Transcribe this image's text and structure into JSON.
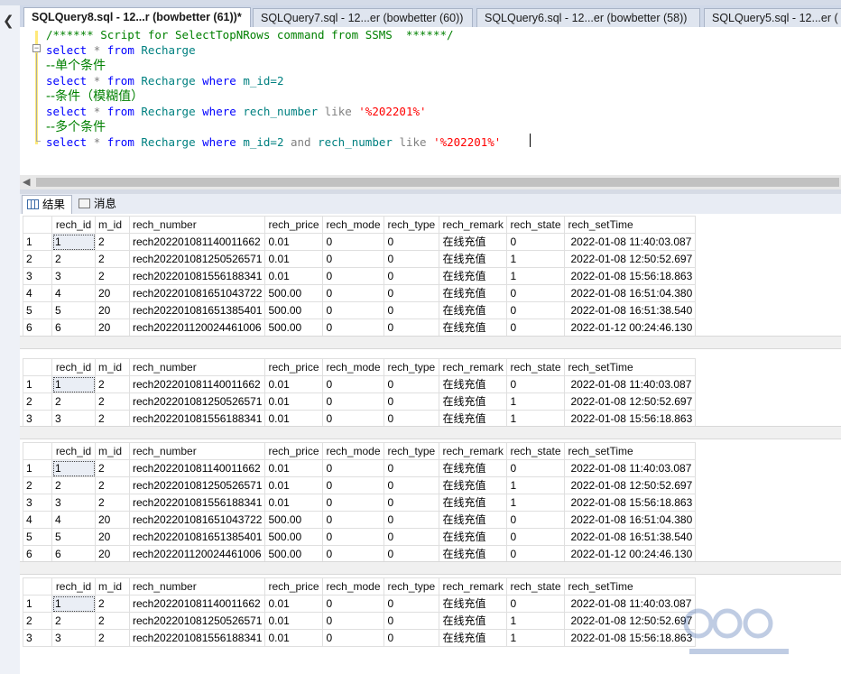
{
  "tabs": [
    {
      "label": "SQLQuery8.sql - 12...r (bowbetter (61))*",
      "close": "",
      "active": true
    },
    {
      "label": "SQLQuery7.sql - 12...er (bowbetter (60))",
      "close": "",
      "active": false
    },
    {
      "label": "SQLQuery6.sql - 12...er (bowbetter (58))",
      "close": "",
      "active": false
    },
    {
      "label": "SQLQuery5.sql - 12...er (",
      "close": "",
      "active": false
    }
  ],
  "editor": {
    "line1": "/****** Script for SelectTopNRows command from SSMS  ******/",
    "line2": {
      "kw1": "select",
      "star": "*",
      "kw2": "from",
      "tbl": "Recharge"
    },
    "line3": "--单个条件",
    "line4": {
      "kw1": "select",
      "star": "*",
      "kw2": "from",
      "tbl": "Recharge",
      "kw3": "where",
      "cond": "m_id=2"
    },
    "line5": "--条件（模糊值）",
    "line6": {
      "kw1": "select",
      "star": "*",
      "kw2": "from",
      "tbl": "Recharge",
      "kw3": "where",
      "col": "rech_number",
      "op": "like",
      "str": "'%202201%'"
    },
    "line7": "--多个条件",
    "line8": {
      "kw1": "select",
      "star": "*",
      "kw2": "from",
      "tbl": "Recharge",
      "kw3": "where",
      "cond": "m_id=2",
      "and": "and",
      "col": "rech_number",
      "op": "like",
      "str": "'%202201%'"
    }
  },
  "result_tabs": {
    "results": "结果",
    "messages": "消息"
  },
  "columns": [
    "rech_id",
    "m_id",
    "rech_number",
    "rech_price",
    "rech_mode",
    "rech_type",
    "rech_remark",
    "rech_state",
    "rech_setTime"
  ],
  "grids": [
    {
      "rows": [
        [
          "1",
          "1",
          "2",
          "rech202201081140011662",
          "0.01",
          "0",
          "0",
          "在线充值",
          "0",
          "2022-01-08 11:40:03.087"
        ],
        [
          "2",
          "2",
          "2",
          "rech202201081250526571",
          "0.01",
          "0",
          "0",
          "在线充值",
          "1",
          "2022-01-08 12:50:52.697"
        ],
        [
          "3",
          "3",
          "2",
          "rech202201081556188341",
          "0.01",
          "0",
          "0",
          "在线充值",
          "1",
          "2022-01-08 15:56:18.863"
        ],
        [
          "4",
          "4",
          "20",
          "rech202201081651043722",
          "500.00",
          "0",
          "0",
          "在线充值",
          "0",
          "2022-01-08 16:51:04.380"
        ],
        [
          "5",
          "5",
          "20",
          "rech202201081651385401",
          "500.00",
          "0",
          "0",
          "在线充值",
          "0",
          "2022-01-08 16:51:38.540"
        ],
        [
          "6",
          "6",
          "20",
          "rech202201120024461006",
          "500.00",
          "0",
          "0",
          "在线充值",
          "0",
          "2022-01-12 00:24:46.130"
        ]
      ]
    },
    {
      "rows": [
        [
          "1",
          "1",
          "2",
          "rech202201081140011662",
          "0.01",
          "0",
          "0",
          "在线充值",
          "0",
          "2022-01-08 11:40:03.087"
        ],
        [
          "2",
          "2",
          "2",
          "rech202201081250526571",
          "0.01",
          "0",
          "0",
          "在线充值",
          "1",
          "2022-01-08 12:50:52.697"
        ],
        [
          "3",
          "3",
          "2",
          "rech202201081556188341",
          "0.01",
          "0",
          "0",
          "在线充值",
          "1",
          "2022-01-08 15:56:18.863"
        ]
      ]
    },
    {
      "rows": [
        [
          "1",
          "1",
          "2",
          "rech202201081140011662",
          "0.01",
          "0",
          "0",
          "在线充值",
          "0",
          "2022-01-08 11:40:03.087"
        ],
        [
          "2",
          "2",
          "2",
          "rech202201081250526571",
          "0.01",
          "0",
          "0",
          "在线充值",
          "1",
          "2022-01-08 12:50:52.697"
        ],
        [
          "3",
          "3",
          "2",
          "rech202201081556188341",
          "0.01",
          "0",
          "0",
          "在线充值",
          "1",
          "2022-01-08 15:56:18.863"
        ],
        [
          "4",
          "4",
          "20",
          "rech202201081651043722",
          "500.00",
          "0",
          "0",
          "在线充值",
          "0",
          "2022-01-08 16:51:04.380"
        ],
        [
          "5",
          "5",
          "20",
          "rech202201081651385401",
          "500.00",
          "0",
          "0",
          "在线充值",
          "0",
          "2022-01-08 16:51:38.540"
        ],
        [
          "6",
          "6",
          "20",
          "rech202201120024461006",
          "500.00",
          "0",
          "0",
          "在线充值",
          "0",
          "2022-01-12 00:24:46.130"
        ]
      ]
    },
    {
      "rows": [
        [
          "1",
          "1",
          "2",
          "rech202201081140011662",
          "0.01",
          "0",
          "0",
          "在线充值",
          "0",
          "2022-01-08 11:40:03.087"
        ],
        [
          "2",
          "2",
          "2",
          "rech202201081250526571",
          "0.01",
          "0",
          "0",
          "在线充值",
          "1",
          "2022-01-08 12:50:52.697"
        ],
        [
          "3",
          "3",
          "2",
          "rech202201081556188341",
          "0.01",
          "0",
          "0",
          "在线充值",
          "1",
          "2022-01-08 15:56:18.863"
        ]
      ]
    }
  ]
}
